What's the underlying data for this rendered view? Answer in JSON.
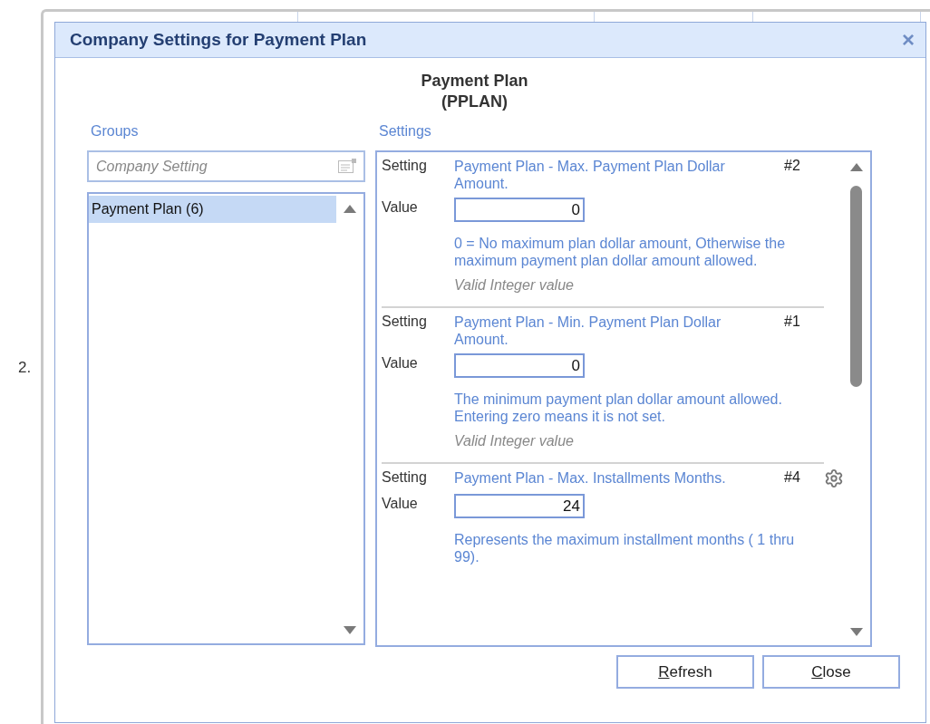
{
  "list_number": "2.",
  "dialog": {
    "title": "Company Settings for Payment Plan",
    "close_glyph": "×"
  },
  "heading": {
    "name": "Payment Plan",
    "code": "(PPLAN)"
  },
  "groups": {
    "label": "Groups",
    "search": {
      "placeholder": "Company Setting"
    },
    "items": [
      {
        "label": "Payment Plan (6)",
        "selected": true
      }
    ]
  },
  "settings": {
    "label": "Settings",
    "rows": [
      {
        "setting_label": "Setting",
        "name": "Payment Plan - Max. Payment Plan Dollar Amount.",
        "number": "#2",
        "has_options": false,
        "value_label": "Value",
        "value": "0",
        "description": "0 = No maximum plan dollar amount, Otherwise the maximum payment plan dollar amount allowed.",
        "validation": "Valid Integer value"
      },
      {
        "setting_label": "Setting",
        "name": "Payment Plan - Min. Payment Plan Dollar Amount.",
        "number": "#1",
        "has_options": false,
        "value_label": "Value",
        "value": "0",
        "description": "The minimum payment plan dollar amount allowed. Entering zero means it is not set.",
        "validation": "Valid Integer value"
      },
      {
        "setting_label": "Setting",
        "name": "Payment Plan - Max. Installments Months.",
        "number": "#4",
        "has_options": true,
        "value_label": "Value",
        "value": "24",
        "description": "Represents the maximum installment months ( 1 thru 99)."
      }
    ]
  },
  "buttons": [
    {
      "mnemonic": "R",
      "label_rest": "efresh"
    },
    {
      "mnemonic": "C",
      "label_rest": "lose"
    }
  ]
}
